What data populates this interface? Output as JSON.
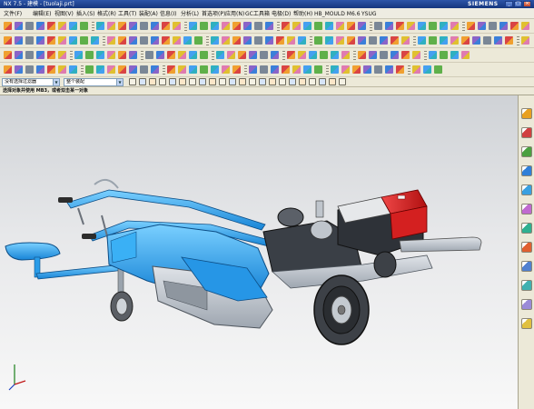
{
  "window": {
    "title": "NX 7.5 - 建模 - [tuolaji.prt]",
    "brand": "SIEMENS",
    "controls": [
      "_",
      "□",
      "×"
    ]
  },
  "menu": {
    "items": [
      "文件(F)",
      "编辑(E)",
      "视图(V)",
      "插入(S)",
      "格式(R)",
      "工具(T)",
      "装配(A)",
      "信息(I)",
      "分析(L)",
      "首选项(P)",
      "应用(N)",
      "GC工具箱",
      "电极(D)",
      "帮助(H)",
      "HB_MOULD M6.6",
      "YSUG"
    ]
  },
  "selection_bar": {
    "filter_value": "没有选择过滤器",
    "scope_value": "整个装配"
  },
  "cue_line": "选择对象并使用 MB3，或者双击某一对象",
  "colors": {
    "titlebar": "#1f45a0",
    "toolbar_bg": "#ece9d8",
    "frame_blue": "#2a9ce8",
    "engine_red": "#d42020",
    "body_gray": "#b8bec6"
  },
  "icons": {
    "resource_bar": [
      "roles-icon",
      "history-icon",
      "part-navigator-icon",
      "web-browser-icon",
      "assembly-navigator-icon",
      "constraint-navigator-icon",
      "reuse-library-icon",
      "hd3d-tools-icon",
      "process-studio-icon",
      "palette-icon",
      "system-materials-icon",
      "visualization-icon"
    ]
  }
}
